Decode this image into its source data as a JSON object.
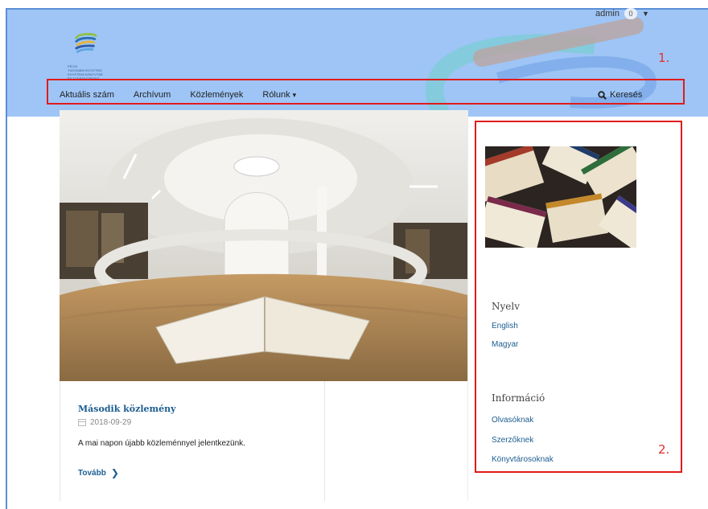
{
  "header": {
    "user": {
      "name": "admin",
      "notifications": "0"
    },
    "logo_text": "PÉCSI TUDOMÁNYEGYETEM\nEGYETEMI KÖNYVTÁR\nÉS TUDÁSKÖZPONT",
    "annotation": "1."
  },
  "nav": {
    "items": [
      {
        "label": "Aktuális szám"
      },
      {
        "label": "Archívum"
      },
      {
        "label": "Közlemények"
      },
      {
        "label": "Rólunk",
        "has_dropdown": true
      }
    ],
    "search_label": "Keresés"
  },
  "announcement": {
    "title": "Második közlemény",
    "date": "2018-09-29",
    "text": "A mai napon újabb közleménnyel jelentkezünk.",
    "more_label": "Tovább"
  },
  "sidebar": {
    "annotation": "2.",
    "language": {
      "heading": "Nyelv",
      "links": [
        "English",
        "Magyar"
      ]
    },
    "information": {
      "heading": "Információ",
      "links": [
        "Olvasóknak",
        "Szerzőknek",
        "Könyvtárosoknak"
      ]
    }
  },
  "colors": {
    "header_bg": "#9ec5f6",
    "highlight_border": "#e01b1b",
    "link": "#1c5d91",
    "annotation": "#e23030"
  }
}
